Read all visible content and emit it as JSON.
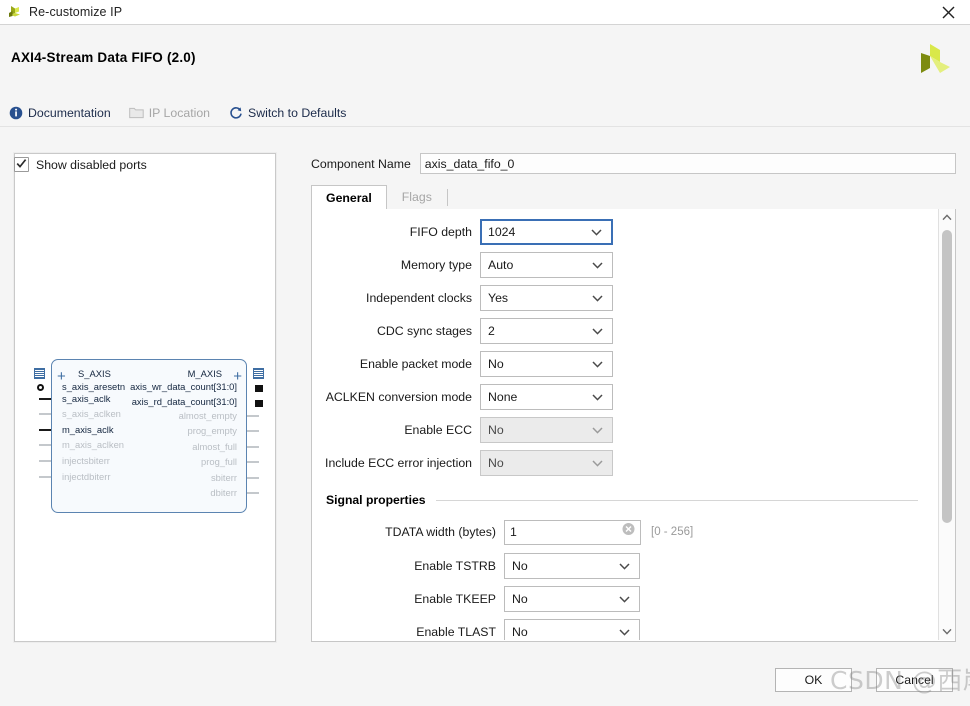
{
  "window": {
    "title": "Re-customize IP",
    "close_label": "×",
    "icon": "xilinx-logo-icon"
  },
  "header": {
    "ip_title": "AXI4-Stream Data FIFO (2.0)",
    "logo": "xilinx-pinwheel-logo"
  },
  "toolbar": {
    "items": [
      {
        "label": "Documentation",
        "icon": "info-icon",
        "disabled": false
      },
      {
        "label": "IP Location",
        "icon": "folder-icon",
        "disabled": true
      },
      {
        "label": "Switch to Defaults",
        "icon": "refresh-icon",
        "disabled": false
      }
    ]
  },
  "diagram": {
    "show_disabled_ports_label": "Show disabled ports",
    "show_disabled_ports_checked": true,
    "bus_left": "S_AXIS",
    "bus_right": "M_AXIS",
    "left_ports": [
      {
        "name": "s_axis_aresetn",
        "dim": false
      },
      {
        "name": "s_axis_aclk",
        "dim": false
      },
      {
        "name": "s_axis_aclken",
        "dim": true
      },
      {
        "name": "m_axis_aclk",
        "dim": false
      },
      {
        "name": "m_axis_aclken",
        "dim": true
      },
      {
        "name": "injectsbiterr",
        "dim": true
      },
      {
        "name": "injectdbiterr",
        "dim": true
      }
    ],
    "right_ports": [
      {
        "name": "axis_wr_data_count[31:0]",
        "dim": false
      },
      {
        "name": "axis_rd_data_count[31:0]",
        "dim": false
      },
      {
        "name": "almost_empty",
        "dim": true
      },
      {
        "name": "prog_empty",
        "dim": true
      },
      {
        "name": "almost_full",
        "dim": true
      },
      {
        "name": "prog_full",
        "dim": true
      },
      {
        "name": "sbiterr",
        "dim": true
      },
      {
        "name": "dbiterr",
        "dim": true
      }
    ]
  },
  "component_name": {
    "label": "Component Name",
    "value": "axis_data_fifo_0"
  },
  "tabs": [
    {
      "label": "General",
      "active": true
    },
    {
      "label": "Flags",
      "active": false
    }
  ],
  "form": {
    "rows": [
      {
        "label": "FIFO depth",
        "value": "1024",
        "type": "select",
        "focused": true,
        "disabled": false,
        "indent": 0
      },
      {
        "label": "Memory type",
        "value": "Auto",
        "type": "select",
        "focused": false,
        "disabled": false,
        "indent": 0
      },
      {
        "label": "Independent clocks",
        "value": "Yes",
        "type": "select",
        "focused": false,
        "disabled": false,
        "indent": 0
      },
      {
        "label": "CDC sync stages",
        "value": "2",
        "type": "select",
        "focused": false,
        "disabled": false,
        "indent": 1
      },
      {
        "label": "Enable packet mode",
        "value": "No",
        "type": "select",
        "focused": false,
        "disabled": false,
        "indent": 0
      },
      {
        "label": "ACLKEN conversion mode",
        "value": "None",
        "type": "select",
        "focused": false,
        "disabled": false,
        "indent": 0
      },
      {
        "label": "Enable ECC",
        "value": "No",
        "type": "select",
        "focused": false,
        "disabled": true,
        "indent": 0
      },
      {
        "label": "Include ECC error injection",
        "value": "No",
        "type": "select",
        "focused": false,
        "disabled": true,
        "indent": 1
      }
    ],
    "section_title": "Signal properties",
    "signal_rows": [
      {
        "label": "TDATA width (bytes)",
        "value": "1",
        "type": "text",
        "hint": "[0 - 256]"
      },
      {
        "label": "Enable TSTRB",
        "value": "No",
        "type": "select",
        "hint": ""
      },
      {
        "label": "Enable TKEEP",
        "value": "No",
        "type": "select",
        "hint": ""
      },
      {
        "label": "Enable TLAST",
        "value": "No",
        "type": "select",
        "hint": ""
      }
    ]
  },
  "footer": {
    "ok_label": "OK",
    "cancel_label": "Cancel"
  },
  "watermark": {
    "text": "CSDN @西岸贤"
  },
  "colors": {
    "accent_blue": "#3a6fb5",
    "link_text": "#1c2b4a",
    "symbol_border": "#5b84b1",
    "logo_dark": "#7d8b10",
    "logo_light": "#d9e84a",
    "panel_bg": "#f5f5f5"
  }
}
